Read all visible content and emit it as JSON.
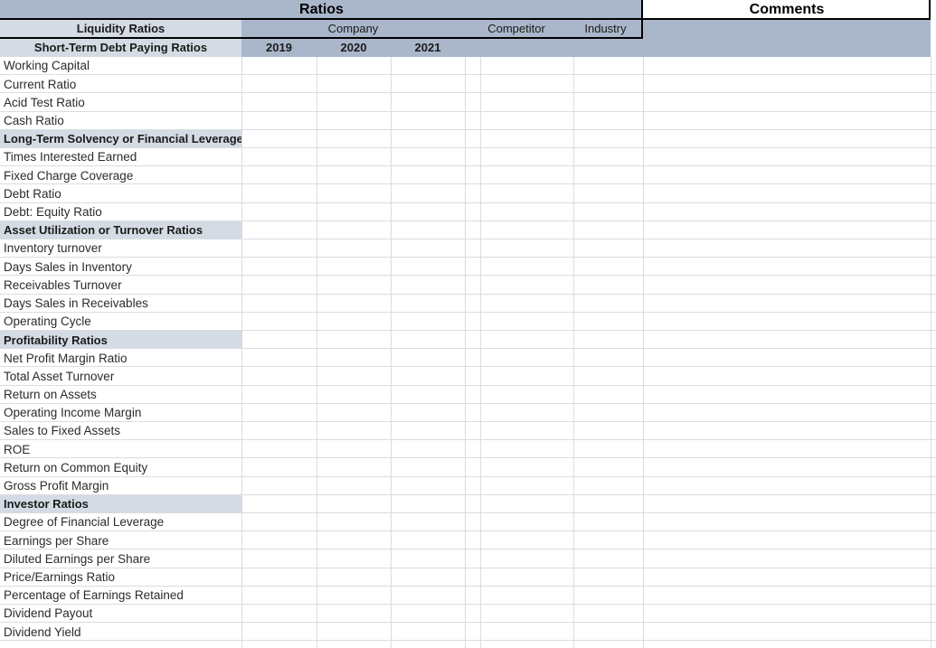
{
  "document": {
    "title": "Ratios",
    "comments_title": "Comments"
  },
  "header": {
    "label_col_title": "Liquidity Ratios",
    "label_col_subtitle": "Short-Term Debt Paying Ratios",
    "company_group": "Company",
    "competitor_group": "Competitor",
    "industry_group": "Industry",
    "years": [
      "2019",
      "2020",
      "2021"
    ]
  },
  "colors": {
    "header_dark": "#aab7cb",
    "header_light": "#d4dbe4",
    "grid_line": "#d9dde2",
    "rule": "#000000",
    "page": "#ffffff"
  },
  "rows": [
    {
      "label": "Working Capital",
      "type": "data"
    },
    {
      "label": "Current Ratio",
      "type": "data"
    },
    {
      "label": "Acid Test Ratio",
      "type": "data"
    },
    {
      "label": "Cash Ratio",
      "type": "data"
    },
    {
      "label": "Long-Term Solvency or Financial Leverage",
      "type": "section"
    },
    {
      "label": "Times Interested Earned",
      "type": "data"
    },
    {
      "label": "Fixed Charge Coverage",
      "type": "data"
    },
    {
      "label": "Debt Ratio",
      "type": "data"
    },
    {
      "label": "Debt: Equity Ratio",
      "type": "data"
    },
    {
      "label": "Asset Utilization or Turnover Ratios",
      "type": "section"
    },
    {
      "label": "Inventory turnover",
      "type": "data"
    },
    {
      "label": "Days Sales in Inventory",
      "type": "data"
    },
    {
      "label": "Receivables Turnover",
      "type": "data"
    },
    {
      "label": "Days Sales in Receivables",
      "type": "data"
    },
    {
      "label": "Operating Cycle",
      "type": "data"
    },
    {
      "label": "Profitability Ratios",
      "type": "section"
    },
    {
      "label": "Net Profit Margin Ratio",
      "type": "data"
    },
    {
      "label": "Total Asset Turnover",
      "type": "data"
    },
    {
      "label": "Return on Assets",
      "type": "data"
    },
    {
      "label": "Operating Income Margin",
      "type": "data"
    },
    {
      "label": "Sales to Fixed Assets",
      "type": "data"
    },
    {
      "label": "ROE",
      "type": "data"
    },
    {
      "label": "Return on Common Equity",
      "type": "data"
    },
    {
      "label": "Gross Profit Margin",
      "type": "data"
    },
    {
      "label": "Investor Ratios",
      "type": "section"
    },
    {
      "label": "Degree of Financial Leverage",
      "type": "data"
    },
    {
      "label": "Earnings per Share",
      "type": "data"
    },
    {
      "label": "Diluted Earnings per Share",
      "type": "data"
    },
    {
      "label": "Price/Earnings Ratio",
      "type": "data"
    },
    {
      "label": "Percentage of Earnings Retained",
      "type": "data"
    },
    {
      "label": "Dividend Payout",
      "type": "data"
    },
    {
      "label": "Dividend Yield",
      "type": "data"
    }
  ],
  "data_columns": [
    {
      "name": "2019",
      "value": ""
    },
    {
      "name": "2020",
      "value": ""
    },
    {
      "name": "2021",
      "value": ""
    },
    {
      "name": "narrow",
      "value": ""
    },
    {
      "name": "competitor",
      "value": ""
    },
    {
      "name": "industry",
      "value": ""
    },
    {
      "name": "comments",
      "value": ""
    }
  ]
}
